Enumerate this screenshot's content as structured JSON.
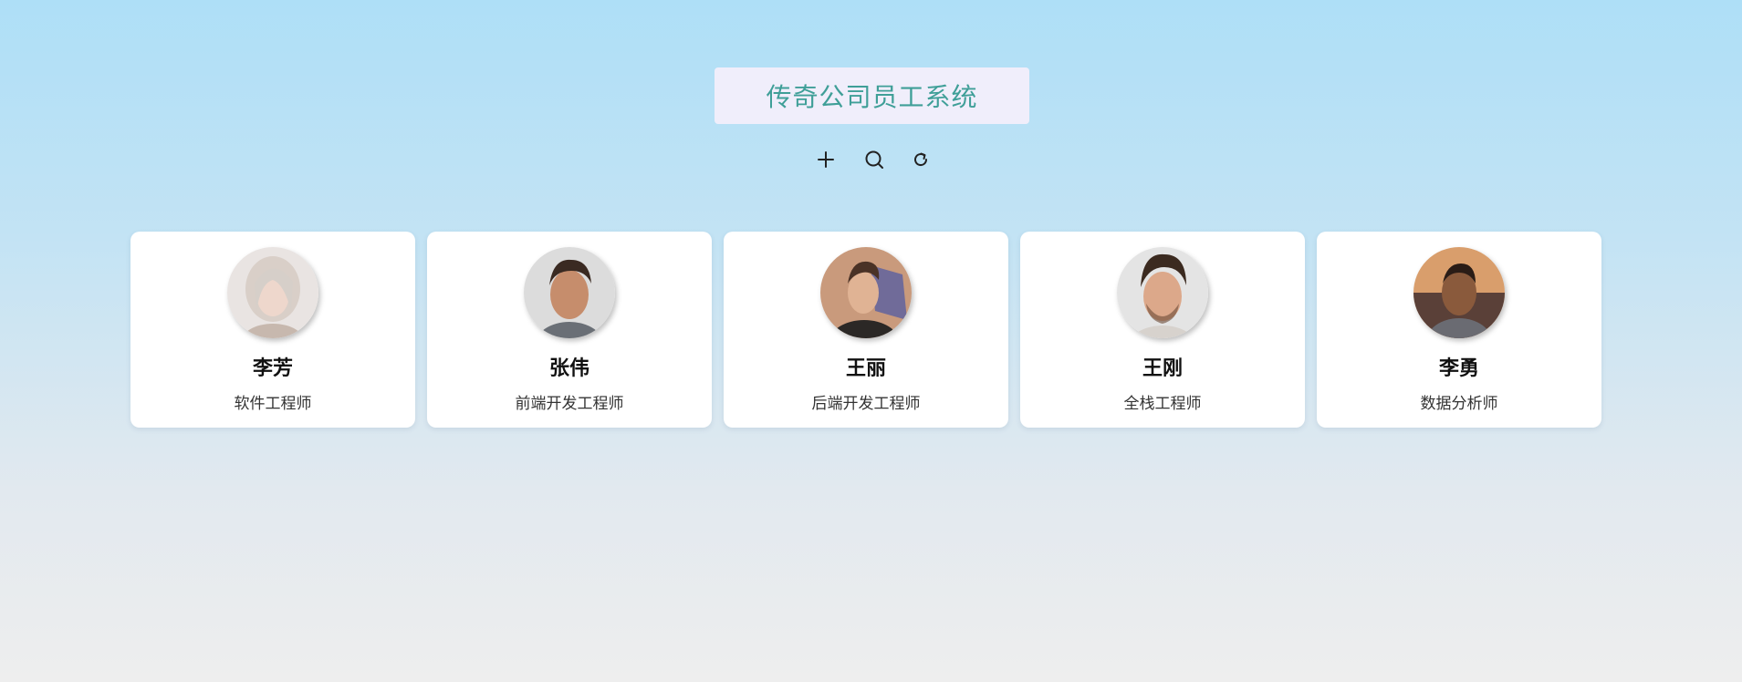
{
  "header": {
    "title": "传奇公司员工系统"
  },
  "toolbar": {
    "buttons": [
      {
        "name": "add",
        "icon": "plus-icon"
      },
      {
        "name": "search",
        "icon": "search-icon"
      },
      {
        "name": "refresh",
        "icon": "refresh-icon"
      }
    ]
  },
  "colors": {
    "title_text": "#3f9f98",
    "title_background": "#f0eefb",
    "card_background": "#ffffff"
  },
  "employees": [
    {
      "name": "李芳",
      "role": "软件工程师"
    },
    {
      "name": "张伟",
      "role": "前端开发工程师"
    },
    {
      "name": "王丽",
      "role": "后端开发工程师"
    },
    {
      "name": "王刚",
      "role": "全栈工程师"
    },
    {
      "name": "李勇",
      "role": "数据分析师"
    }
  ]
}
